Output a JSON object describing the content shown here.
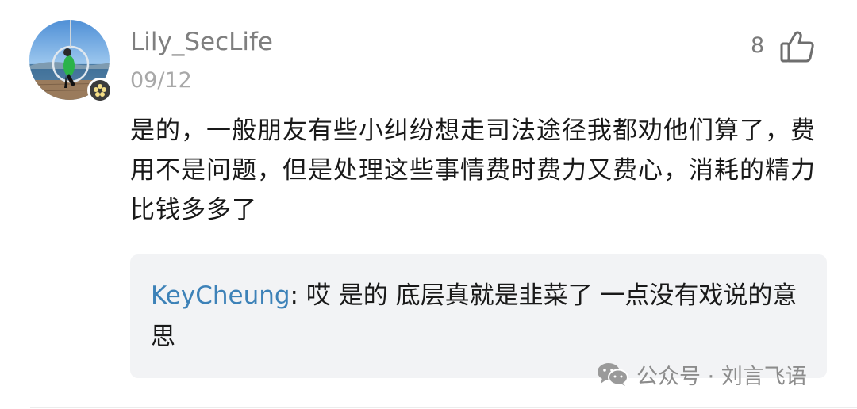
{
  "comment": {
    "username": "Lily_SecLife",
    "date": "09/12",
    "likes": "8",
    "text": "是的，一般朋友有些小纠纷想走司法途径我都劝他们算了，费用不是问题，但是处理这些事情费时费力又费心，消耗的精力比钱多多了"
  },
  "reply": {
    "author": "KeyCheung",
    "separator": ": ",
    "text": "哎 是的 底层真就是韭菜了 一点没有戏说的意思"
  },
  "watermark": {
    "text": "公众号 · 刘言飞语"
  },
  "icons": {
    "like": "thumbs-up-icon",
    "badge": "flower-badge-icon",
    "watermark": "wechat-icon"
  }
}
